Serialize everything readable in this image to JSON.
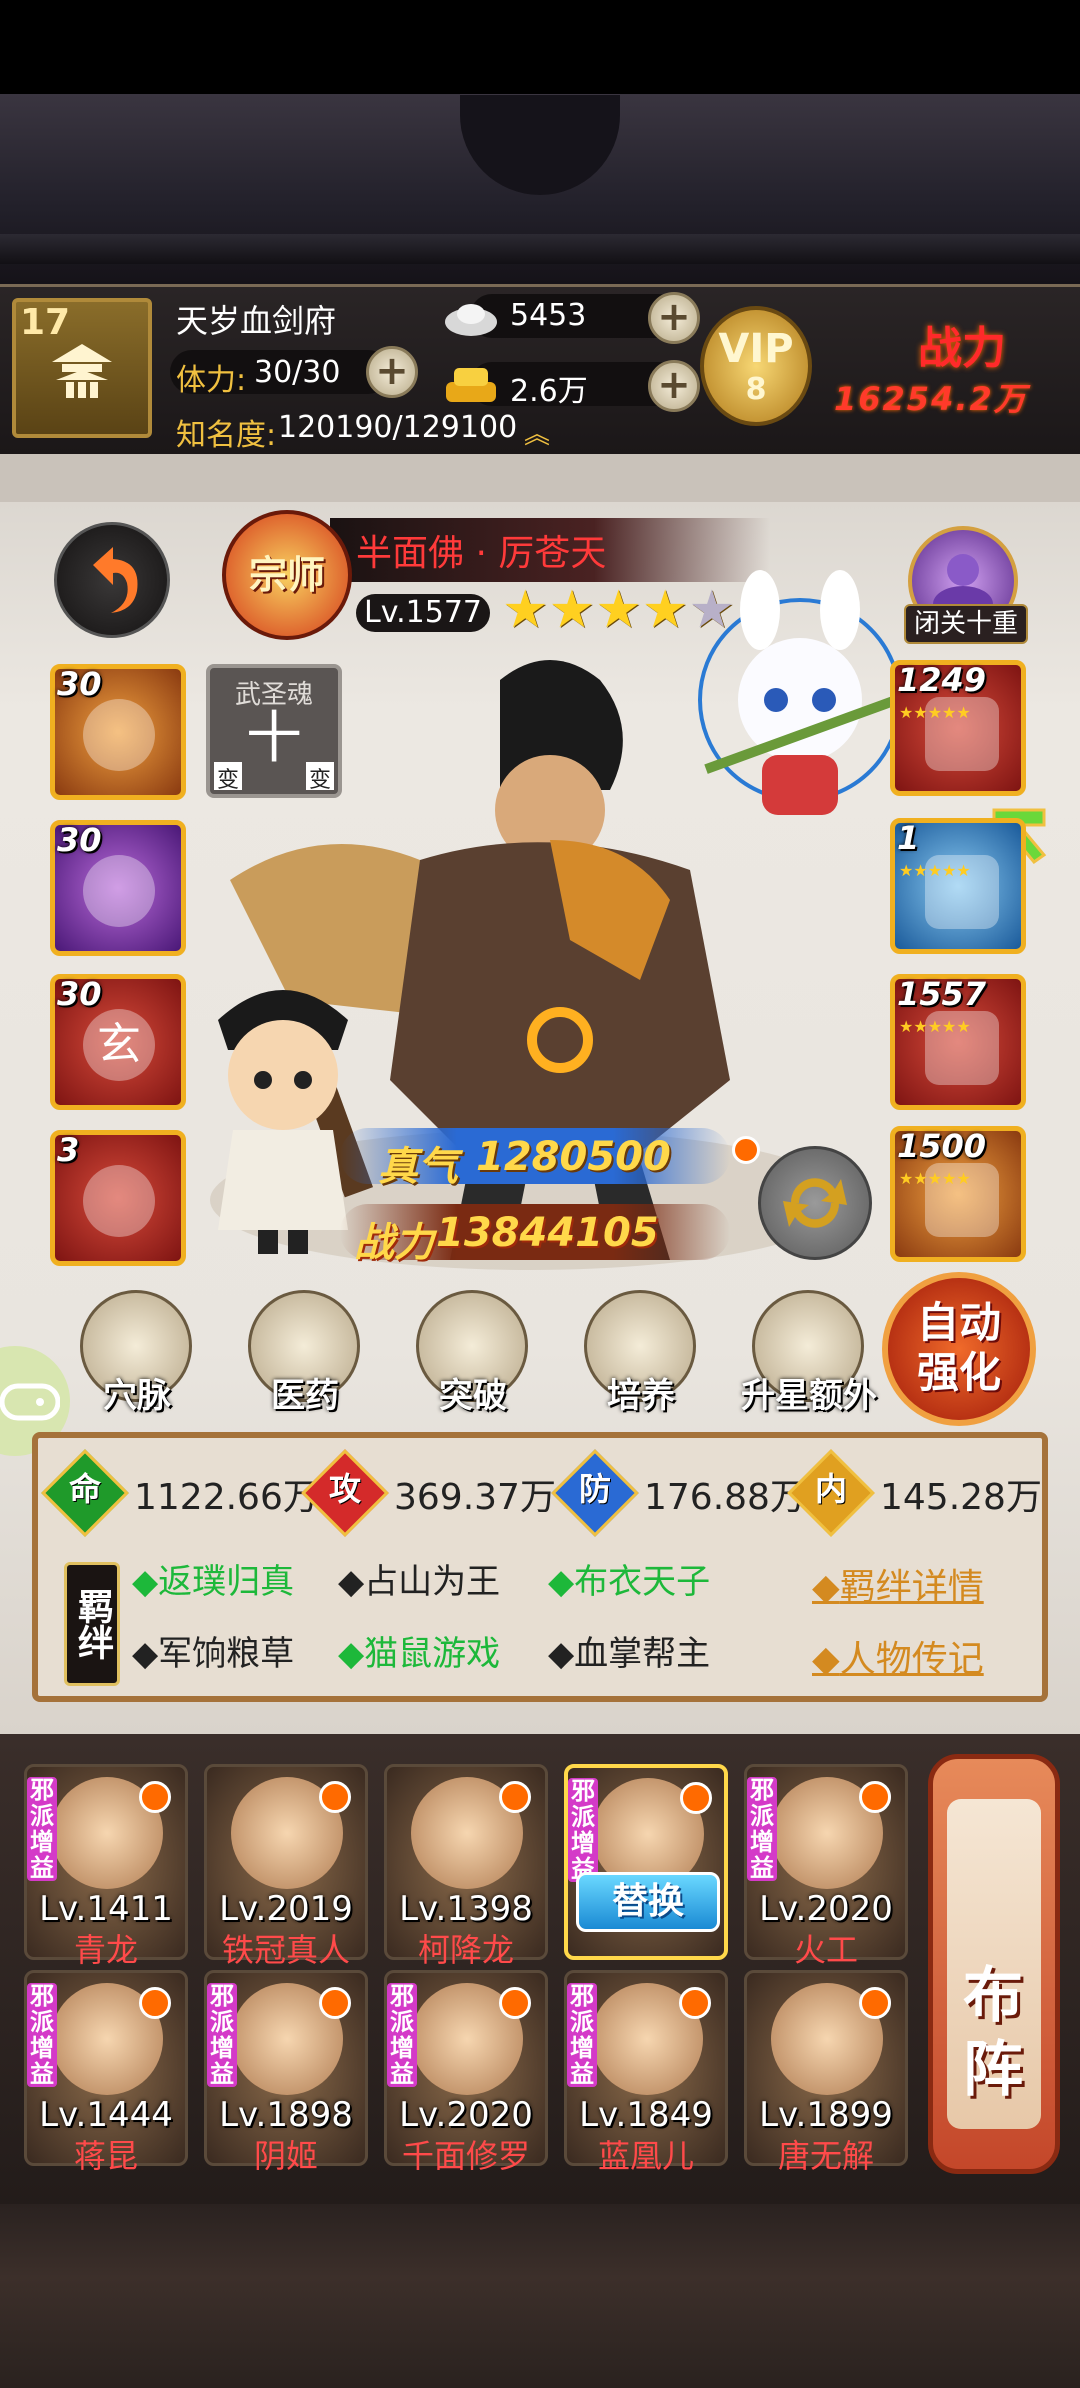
{
  "header": {
    "player_level": "17",
    "player_name": "天岁血剑府",
    "stamina_label": "体力:",
    "stamina_value": "30/30",
    "fame_label": "知名度:",
    "fame_value": "120190/129100",
    "silver": "5453",
    "gold": "2.6万",
    "vip_label": "VIP",
    "vip_level": "8",
    "power_label": "战力",
    "power_value": "16254.2万"
  },
  "hero": {
    "badge": "宗师",
    "name": "半面佛 · 厉苍天",
    "level": "Lv.1577",
    "stars_filled": 4,
    "stars_total": 5,
    "true_qi_label": "真气",
    "true_qi_value": "1280500",
    "power_label": "战力",
    "power_value": "13844105",
    "seclusion_label": "闭关十重"
  },
  "left_slots": [
    {
      "num": "30",
      "color": "orange",
      "icon": "palm-icon"
    },
    {
      "num": "30",
      "color": "purple",
      "icon": "fist-icon"
    },
    {
      "num": "30",
      "color": "red",
      "icon": "xuan-icon",
      "char": "玄"
    },
    {
      "num": "3",
      "color": "red",
      "icon": "medallion-icon"
    }
  ],
  "soul_slot": {
    "title": "武圣魂",
    "char": "十",
    "left": "变",
    "right": "变"
  },
  "right_slots": [
    {
      "num": "1249",
      "color": "red",
      "icon": "weapon-icon"
    },
    {
      "num": "1",
      "color": "blue",
      "icon": "armor-icon"
    },
    {
      "num": "1557",
      "color": "red",
      "icon": "scroll-icon"
    },
    {
      "num": "1500",
      "color": "orange",
      "icon": "rabbit-pet-icon"
    }
  ],
  "menu": [
    {
      "label": "穴脉",
      "icon": "meridian-icon"
    },
    {
      "label": "医药",
      "icon": "herb-icon"
    },
    {
      "label": "突破",
      "icon": "breakthrough-icon"
    },
    {
      "label": "培养",
      "icon": "training-icon"
    },
    {
      "label": "升星额外",
      "icon": "star-up-icon"
    }
  ],
  "auto_strengthen": "自动强化",
  "stats": [
    {
      "badge": "命",
      "value": "1122.66万",
      "color": "#1f9a2a"
    },
    {
      "badge": "攻",
      "value": "369.37万",
      "color": "#d42a2a"
    },
    {
      "badge": "防",
      "value": "176.88万",
      "color": "#2a6ad4"
    },
    {
      "badge": "内",
      "value": "145.28万",
      "color": "#e0a020"
    }
  ],
  "bonds_label": "羁绊",
  "bonds": [
    {
      "text": "返璞归真",
      "active": true
    },
    {
      "text": "占山为王",
      "active": false
    },
    {
      "text": "布衣天子",
      "active": true
    },
    {
      "text": "军饷粮草",
      "active": false
    },
    {
      "text": "猫鼠游戏",
      "active": true
    },
    {
      "text": "血掌帮主",
      "active": false
    }
  ],
  "links": {
    "bond_detail": "羁绊详情",
    "biography": "人物传记"
  },
  "team_tag": "邪派增益",
  "replace_label": "替换",
  "team": [
    {
      "level": "Lv.1411",
      "name": "青龙",
      "tag": true,
      "selected": false
    },
    {
      "level": "Lv.2019",
      "name": "铁冠真人",
      "tag": false,
      "selected": false
    },
    {
      "level": "Lv.1398",
      "name": "柯降龙",
      "tag": false,
      "selected": false
    },
    {
      "level": "",
      "name": "",
      "tag": true,
      "selected": true
    },
    {
      "level": "Lv.2020",
      "name": "火工",
      "tag": true,
      "selected": false
    },
    {
      "level": "Lv.1444",
      "name": "蒋昆",
      "tag": true,
      "selected": false
    },
    {
      "level": "Lv.1898",
      "name": "阴姬",
      "tag": true,
      "selected": false
    },
    {
      "level": "Lv.2020",
      "name": "千面修罗",
      "tag": true,
      "selected": false
    },
    {
      "level": "Lv.1849",
      "name": "蓝凰儿",
      "tag": true,
      "selected": false
    },
    {
      "level": "Lv.1899",
      "name": "唐无解",
      "tag": false,
      "selected": false
    }
  ],
  "formation_label": "布阵"
}
